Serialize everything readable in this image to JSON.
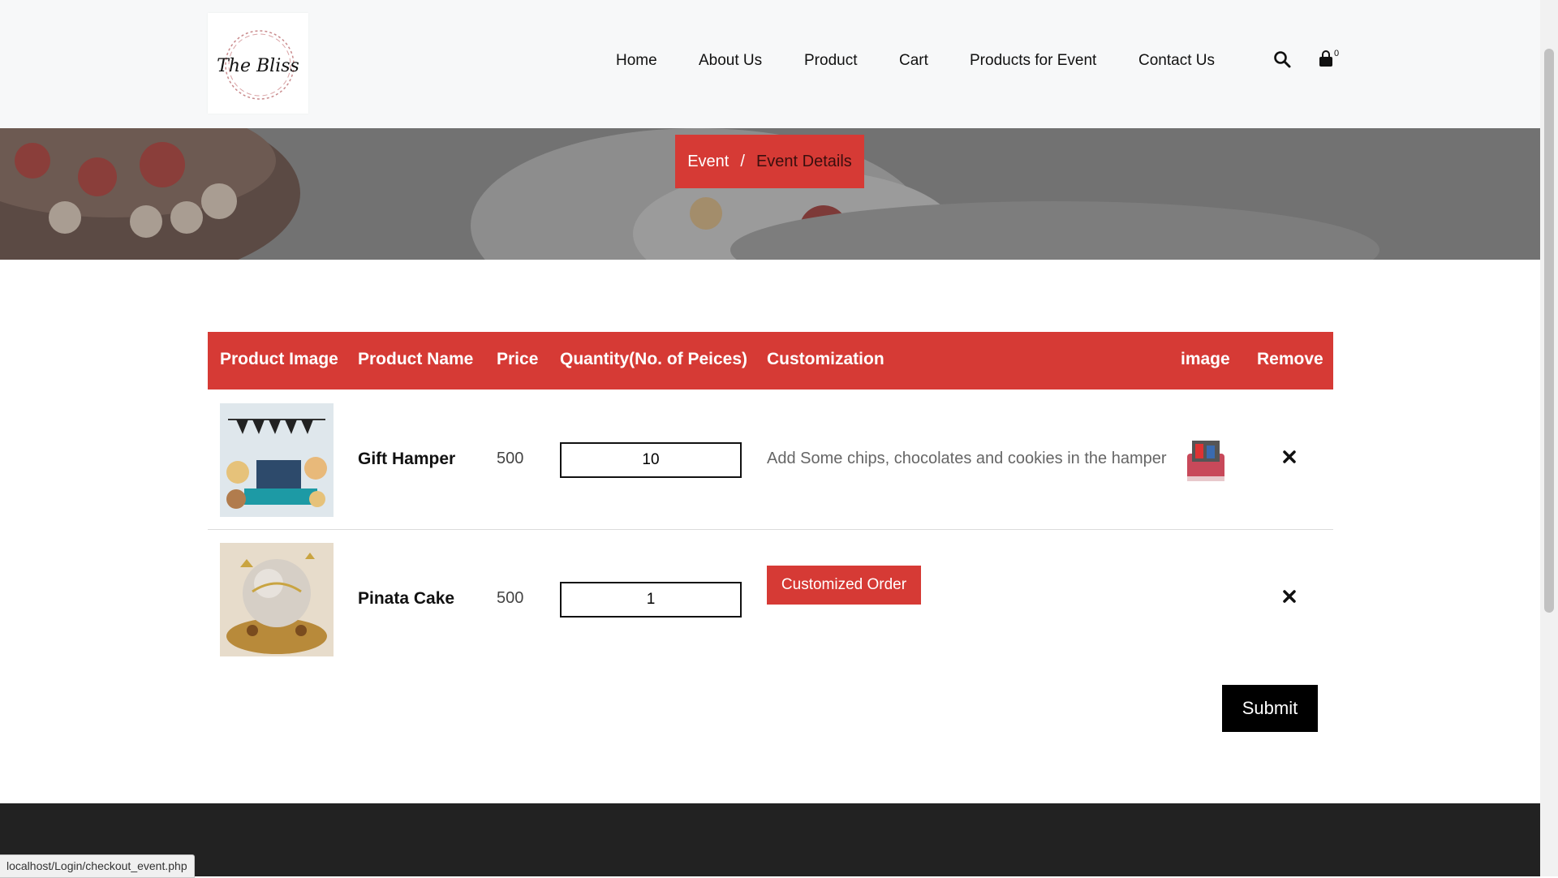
{
  "logo": {
    "text": "The Bliss"
  },
  "nav": {
    "items": [
      {
        "label": "Home"
      },
      {
        "label": "About Us"
      },
      {
        "label": "Product"
      },
      {
        "label": "Cart"
      },
      {
        "label": "Products for Event"
      },
      {
        "label": "Contact Us"
      }
    ],
    "cart_count": "0"
  },
  "breadcrumb": {
    "items": [
      "Event",
      "Event Details"
    ],
    "separator": "/"
  },
  "table": {
    "headers": [
      "Product Image",
      "Product Name",
      "Price",
      "Quantity(No. of Peices)",
      "Customization",
      "image",
      "Remove"
    ],
    "rows": [
      {
        "name": "Gift Hamper",
        "price": "500",
        "quantity": "10",
        "customization": "Add Some chips, chocolates and cookies in the hamper"
      },
      {
        "name": "Pinata Cake",
        "price": "500",
        "quantity": "1",
        "customization_button": "Customized Order"
      }
    ]
  },
  "submit_label": "Submit",
  "status_bar": {
    "url": "localhost/Login/checkout_event.php"
  },
  "colors": {
    "accent": "#d63a35",
    "header_bg": "#f7f8f9",
    "footer_bg": "#222222",
    "button_dark": "#000000"
  }
}
